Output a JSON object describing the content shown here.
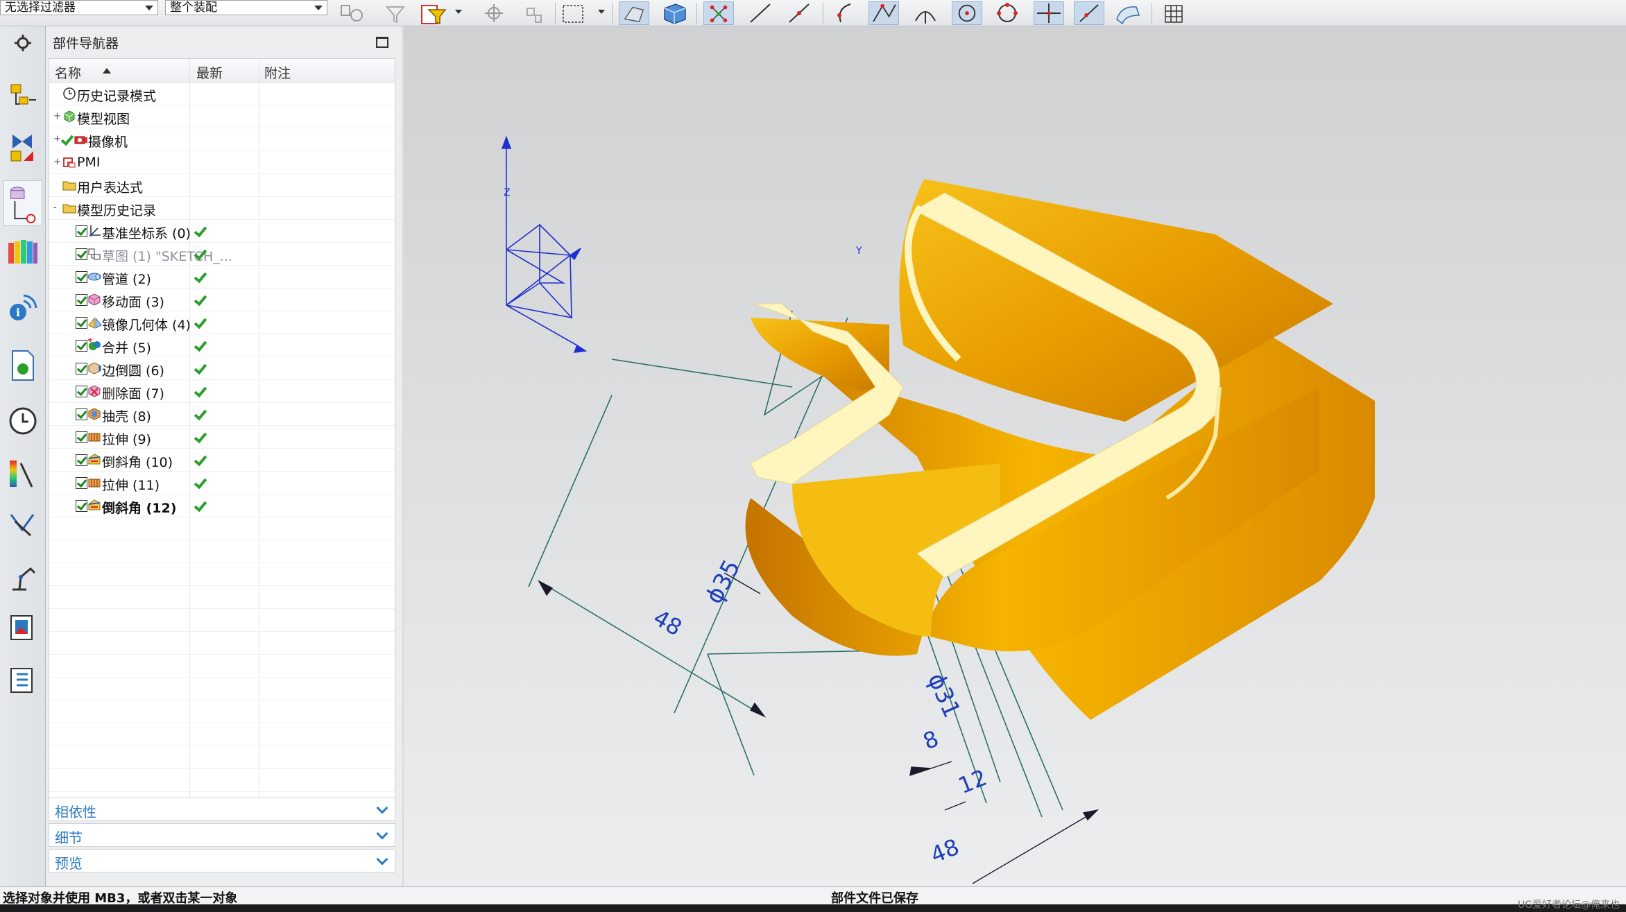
{
  "toolbar": {
    "filter_value": "无选择过滤器",
    "scope_value": "整个装配"
  },
  "navigator": {
    "title": "部件导航器",
    "columns": {
      "name": "名称",
      "latest": "最新",
      "note": "附注"
    },
    "tree": [
      {
        "label": "历史记录模式",
        "kind": "clock"
      },
      {
        "label": "模型视图",
        "kind": "views",
        "expand": "+"
      },
      {
        "label": "摄像机",
        "kind": "camera",
        "expand": "+"
      },
      {
        "label": "PMI",
        "kind": "pmi",
        "expand": "+"
      },
      {
        "label": "用户表达式",
        "kind": "folder"
      },
      {
        "label": "模型历史记录",
        "kind": "folder",
        "expand": "-"
      }
    ],
    "features": [
      {
        "label": "基准坐标系 (0)",
        "state": "normal"
      },
      {
        "label": "草图 (1) \"SKETCH_...",
        "state": "gray"
      },
      {
        "label": "管道 (2)",
        "state": "normal"
      },
      {
        "label": "移动面 (3)",
        "state": "normal"
      },
      {
        "label": "镜像几何体 (4)",
        "state": "normal"
      },
      {
        "label": "合并 (5)",
        "state": "normal"
      },
      {
        "label": "边倒圆 (6)",
        "state": "normal"
      },
      {
        "label": "删除面 (7)",
        "state": "normal"
      },
      {
        "label": "抽壳 (8)",
        "state": "normal"
      },
      {
        "label": "拉伸 (9)",
        "state": "normal"
      },
      {
        "label": "倒斜角 (10)",
        "state": "normal"
      },
      {
        "label": "拉伸 (11)",
        "state": "normal"
      },
      {
        "label": "倒斜角 (12)",
        "state": "bold"
      }
    ],
    "sections": {
      "dependency": "相依性",
      "details": "细节",
      "preview": "预览"
    }
  },
  "viewport": {
    "axes": {
      "z": "Z",
      "y": "Y"
    },
    "dimensions": {
      "d_phi35": "ϕ35",
      "d_48_left": "48",
      "d_phi31": "ϕ31",
      "d_8": "8",
      "d_12": "12",
      "d_48_bottom": "48"
    }
  },
  "status": {
    "left": "选择对象并使用 MB3，或者双击某一对象",
    "center": "部件文件已保存"
  },
  "watermark": "UG爱好者论坛@俺来也",
  "colors": {
    "part_main": "#f2b400",
    "part_top": "#fff6bf",
    "dimension": "#2c6f6a",
    "dimension_text": "#1e3fb8",
    "accent_blue": "#2b79c2",
    "check_green": "#2aa02a"
  }
}
